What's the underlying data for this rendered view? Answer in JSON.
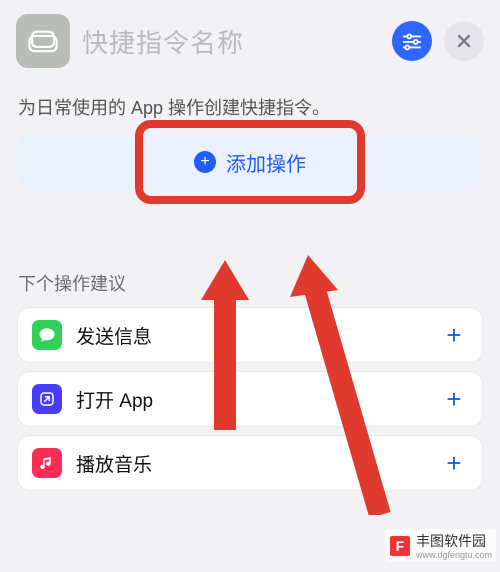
{
  "header": {
    "title_placeholder": "快捷指令名称"
  },
  "subtitle": "为日常使用的 App 操作创建快捷指令。",
  "add_action_label": "添加操作",
  "suggestions_header": "下个操作建议",
  "suggestions": [
    {
      "label": "发送信息",
      "icon": "message"
    },
    {
      "label": "打开 App",
      "icon": "open-app"
    },
    {
      "label": "播放音乐",
      "icon": "music"
    }
  ],
  "watermark": {
    "name": "丰图软件园",
    "url": "www.dgfengtu.com"
  }
}
